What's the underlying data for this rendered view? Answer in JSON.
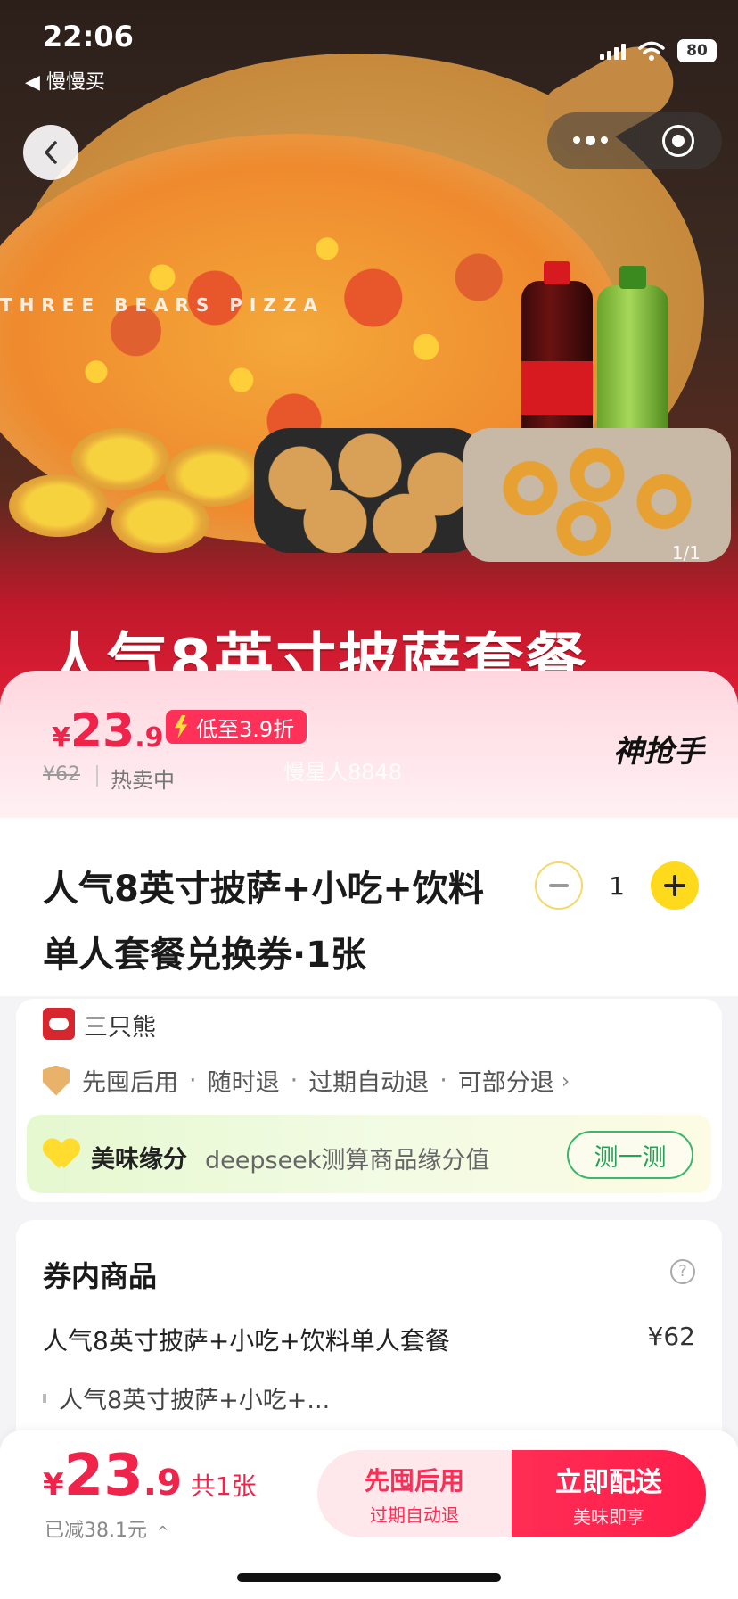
{
  "status_bar": {
    "time": "22:06",
    "back_app": "◀ 慢慢买",
    "battery": "80",
    "icons": [
      "signal-icon",
      "wifi-icon",
      "battery-icon"
    ]
  },
  "hero": {
    "banner_text": "人气8英寸披萨套餐",
    "brand_watermark": "THREE BEARS PIZZA",
    "image_counter": "1/1"
  },
  "price_card": {
    "currency": "¥",
    "price_int": "23",
    "price_dec": ".9",
    "discount_tag": "低至3.9折",
    "original_price": "¥62",
    "status": "热卖中",
    "program_logo": "神抢手",
    "watermark": "慢星人8848"
  },
  "product": {
    "title": "人气8英寸披萨+小吃+饮料单人套餐兑换券·1张",
    "quantity": "1"
  },
  "shop": {
    "name": "三只熊",
    "guarantees": [
      "先囤后用",
      "随时退",
      "过期自动退",
      "可部分退"
    ],
    "separator": "·",
    "chevron": "›"
  },
  "fate": {
    "title": "美味缘分",
    "description": "deepseek测算商品缘分值",
    "button_label": "测一测"
  },
  "voucher": {
    "section_title": "券内商品",
    "help": "?",
    "item_name": "人气8英寸披萨+小吃+饮料单人套餐",
    "item_price": "¥62",
    "sub_item": "人气8英寸披萨+小吃+..."
  },
  "bottom_bar": {
    "currency": "¥",
    "price_int": "23",
    "price_dec": ".9",
    "count": "共1张",
    "saved": "已减38.1元",
    "saved_chevron": "^",
    "later_title": "先囤后用",
    "later_sub": "过期自动退",
    "buy_title": "立即配送",
    "buy_sub": "美味即享"
  },
  "colors": {
    "accent": "#f0244b",
    "button_primary": "#ff2d55",
    "plus_button": "#ffd91b",
    "fate_button": "#39b86a"
  }
}
